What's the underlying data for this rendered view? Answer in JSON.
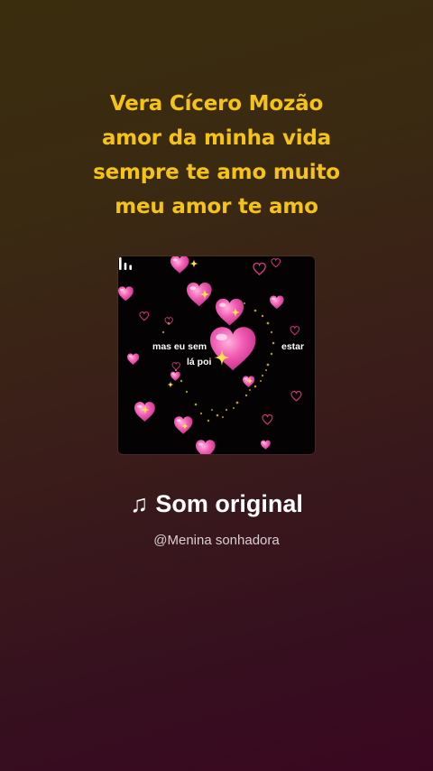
{
  "caption": {
    "lines": [
      "Vera Cícero Mozão",
      "amor da minha vida",
      "sempre te amo muito",
      "meu amor te amo"
    ]
  },
  "cover": {
    "overlay_line1_left": "mas eu sem",
    "overlay_line1_right": "estar",
    "overlay_line2": "lá poi",
    "icon": "equalizer-bars-icon"
  },
  "sound": {
    "note_icon": "♫",
    "title": "Som original",
    "author": "@Menina sonhadora"
  },
  "colors": {
    "caption_text": "#f5c318",
    "heart_pink": "#f45fb6",
    "sparkle_yellow": "#ffe14a"
  }
}
